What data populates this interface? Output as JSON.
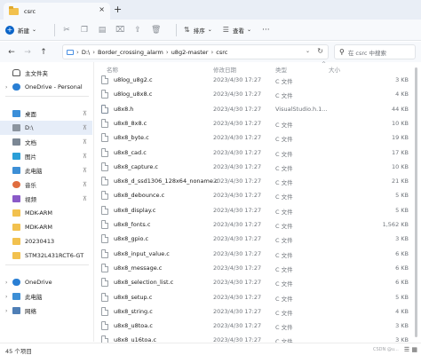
{
  "tab": {
    "title": "csrc",
    "close": "×",
    "add": "+"
  },
  "toolbar": {
    "new_label": "新建",
    "sort_label": "排序",
    "view_label": "查看",
    "more": "···"
  },
  "address": {
    "segments": [
      "D:\\",
      "Border_crossing_alarm",
      "u8g2-master",
      "csrc"
    ],
    "search_placeholder": "在 csrc 中搜索"
  },
  "sidebar": {
    "items": [
      {
        "label": "主文件夹",
        "icon": "home-icon",
        "exp": ""
      },
      {
        "label": "OneDrive - Personal",
        "icon": "cloud-icon",
        "exp": "›"
      },
      {
        "label": "桌面",
        "icon": "desktop-icon",
        "exp": "",
        "pinned": true
      },
      {
        "label": "D:\\",
        "icon": "drive-icon",
        "exp": "",
        "pinned": true,
        "selected": true
      },
      {
        "label": "文档",
        "icon": "document-icon",
        "exp": "",
        "pinned": true
      },
      {
        "label": "图片",
        "icon": "picture-icon",
        "exp": "",
        "pinned": true
      },
      {
        "label": "此电脑",
        "icon": "computer-icon",
        "exp": "",
        "pinned": true
      },
      {
        "label": "音乐",
        "icon": "music-icon",
        "exp": "",
        "pinned": true
      },
      {
        "label": "视频",
        "icon": "video-icon",
        "exp": "",
        "pinned": true
      },
      {
        "label": "MDK-ARM",
        "icon": "folder-icon",
        "exp": ""
      },
      {
        "label": "MDK-ARM",
        "icon": "folder-icon",
        "exp": ""
      },
      {
        "label": "20230413",
        "icon": "folder-icon",
        "exp": ""
      },
      {
        "label": "STM32L431RCT6-GT",
        "icon": "folder-icon",
        "exp": ""
      },
      {
        "label": "OneDrive",
        "icon": "cloud-icon",
        "exp": "›"
      },
      {
        "label": "此电脑",
        "icon": "computer-icon",
        "exp": "›"
      },
      {
        "label": "网络",
        "icon": "network-icon",
        "exp": "›"
      }
    ],
    "pin_glyph": "⊼"
  },
  "columns": {
    "name": "名称",
    "date": "修改日期",
    "type": "类型",
    "size": "大小"
  },
  "files": [
    {
      "name": "u8log_u8g2.c",
      "date": "2023/4/30 17:27",
      "type": "C 文件",
      "size": "3 KB"
    },
    {
      "name": "u8log_u8x8.c",
      "date": "2023/4/30 17:27",
      "type": "C 文件",
      "size": "4 KB"
    },
    {
      "name": "u8x8.h",
      "date": "2023/4/30 17:27",
      "type": "VisualStudio.h.1...",
      "size": "44 KB",
      "header": true
    },
    {
      "name": "u8x8_8x8.c",
      "date": "2023/4/30 17:27",
      "type": "C 文件",
      "size": "10 KB"
    },
    {
      "name": "u8x8_byte.c",
      "date": "2023/4/30 17:27",
      "type": "C 文件",
      "size": "19 KB"
    },
    {
      "name": "u8x8_cad.c",
      "date": "2023/4/30 17:27",
      "type": "C 文件",
      "size": "17 KB"
    },
    {
      "name": "u8x8_capture.c",
      "date": "2023/4/30 17:27",
      "type": "C 文件",
      "size": "10 KB"
    },
    {
      "name": "u8x8_d_ssd1306_128x64_noname.c",
      "date": "2023/4/30 17:27",
      "type": "C 文件",
      "size": "21 KB"
    },
    {
      "name": "u8x8_debounce.c",
      "date": "2023/4/30 17:27",
      "type": "C 文件",
      "size": "5 KB"
    },
    {
      "name": "u8x8_display.c",
      "date": "2023/4/30 17:27",
      "type": "C 文件",
      "size": "5 KB"
    },
    {
      "name": "u8x8_fonts.c",
      "date": "2023/4/30 17:27",
      "type": "C 文件",
      "size": "1,562 KB"
    },
    {
      "name": "u8x8_gpio.c",
      "date": "2023/4/30 17:27",
      "type": "C 文件",
      "size": "3 KB"
    },
    {
      "name": "u8x8_input_value.c",
      "date": "2023/4/30 17:27",
      "type": "C 文件",
      "size": "6 KB"
    },
    {
      "name": "u8x8_message.c",
      "date": "2023/4/30 17:27",
      "type": "C 文件",
      "size": "6 KB"
    },
    {
      "name": "u8x8_selection_list.c",
      "date": "2023/4/30 17:27",
      "type": "C 文件",
      "size": "6 KB"
    },
    {
      "name": "u8x8_setup.c",
      "date": "2023/4/30 17:27",
      "type": "C 文件",
      "size": "5 KB"
    },
    {
      "name": "u8x8_string.c",
      "date": "2023/4/30 17:27",
      "type": "C 文件",
      "size": "4 KB"
    },
    {
      "name": "u8x8_u8toa.c",
      "date": "2023/4/30 17:27",
      "type": "C 文件",
      "size": "3 KB"
    },
    {
      "name": "u8x8_u16toa.c",
      "date": "2023/4/30 17:27",
      "type": "C 文件",
      "size": "3 KB"
    }
  ],
  "status": {
    "count": "45 个项目",
    "watermark": "CSDN @u..."
  }
}
